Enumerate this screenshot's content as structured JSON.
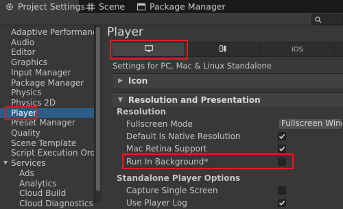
{
  "tabs": [
    {
      "label": "Project Settings",
      "icon": "gear-icon"
    },
    {
      "label": "Scene",
      "icon": "grid-icon"
    },
    {
      "label": "Package Manager",
      "icon": "package-icon"
    }
  ],
  "search": {
    "icon": "search-icon"
  },
  "sidebar": {
    "items": [
      {
        "label": "Adaptive Performance"
      },
      {
        "label": "Audio"
      },
      {
        "label": "Editor"
      },
      {
        "label": "Graphics"
      },
      {
        "label": "Input Manager"
      },
      {
        "label": "Package Manager"
      },
      {
        "label": "Physics"
      },
      {
        "label": "Physics 2D"
      },
      {
        "label": "Player"
      },
      {
        "label": "Preset Manager"
      },
      {
        "label": "Quality"
      },
      {
        "label": "Scene Template"
      },
      {
        "label": "Script Execution Order"
      },
      {
        "label": "Services"
      },
      {
        "label": "Ads"
      },
      {
        "label": "Analytics"
      },
      {
        "label": "Cloud Build"
      },
      {
        "label": "Cloud Diagnostics"
      }
    ],
    "selected": "Player"
  },
  "main": {
    "title": "Player",
    "platform_tabs": [
      {
        "icon": "monitor-icon",
        "label": ""
      },
      {
        "icon": "switch-icon",
        "label": ""
      },
      {
        "icon": "",
        "label": "iOS"
      },
      {
        "icon": "",
        "label": ""
      }
    ],
    "settings_for": "Settings for PC, Mac & Linux Standalone",
    "sections": {
      "icon": "Icon",
      "resolution_presentation": "Resolution and Presentation"
    },
    "resolution": {
      "subheading": "Resolution",
      "fullscreen_mode_label": "Fullscreen Mode",
      "fullscreen_mode_value": "Fullscreen Window",
      "default_native_label": "Default Is Native Resolution",
      "default_native_checked": true,
      "mac_retina_label": "Mac Retina Support",
      "mac_retina_checked": true,
      "run_in_background_label": "Run In Background*",
      "run_in_background_checked": false
    },
    "standalone": {
      "subheading": "Standalone Player Options",
      "capture_single_screen_label": "Capture Single Screen",
      "capture_single_screen_checked": false,
      "use_player_log_label": "Use Player Log",
      "use_player_log_checked": true
    }
  },
  "colors": {
    "highlight": "#e01e1e",
    "selected": "#2c5d87",
    "background": "#383838"
  }
}
